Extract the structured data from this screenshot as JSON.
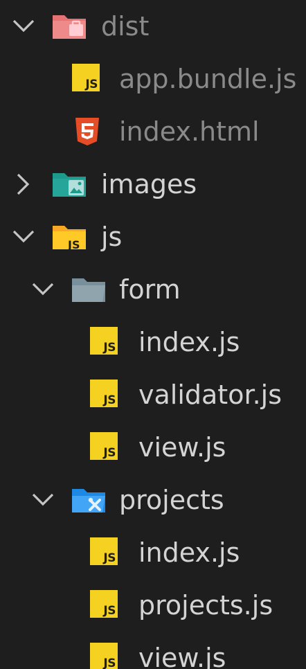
{
  "tree": {
    "dist": {
      "label": "dist",
      "expanded": true,
      "icon": "folder-dist-icon",
      "children": {
        "app_bundle": {
          "label": "app.bundle.js",
          "icon": "javascript-file-icon",
          "js_badge": "JS"
        },
        "index_html": {
          "label": "index.html",
          "icon": "html5-file-icon"
        }
      }
    },
    "images": {
      "label": "images",
      "expanded": false,
      "icon": "folder-images-icon"
    },
    "js": {
      "label": "js",
      "expanded": true,
      "icon": "folder-js-icon",
      "children": {
        "form": {
          "label": "form",
          "expanded": true,
          "icon": "folder-icon",
          "children": {
            "index": {
              "label": "index.js",
              "icon": "javascript-file-icon",
              "js_badge": "JS"
            },
            "validator": {
              "label": "validator.js",
              "icon": "javascript-file-icon",
              "js_badge": "JS"
            },
            "view": {
              "label": "view.js",
              "icon": "javascript-file-icon",
              "js_badge": "JS"
            }
          }
        },
        "projects": {
          "label": "projects",
          "expanded": true,
          "icon": "folder-projects-icon",
          "children": {
            "index": {
              "label": "index.js",
              "icon": "javascript-file-icon",
              "js_badge": "JS"
            },
            "projects": {
              "label": "projects.js",
              "icon": "javascript-file-icon",
              "js_badge": "JS"
            },
            "view": {
              "label": "view.js",
              "icon": "javascript-file-icon",
              "js_badge": "JS"
            }
          }
        }
      }
    }
  },
  "colors": {
    "background": "#1e1e1e",
    "text": "#d4d4d4",
    "text_dimmed": "#8a8a8a",
    "chevron": "#c5c5c5",
    "js_badge": "#f5d222",
    "html5": "#e44d26",
    "folder_dist": "#e57373",
    "folder_images": "#26a69a",
    "folder_js": "#ffca28",
    "folder_plain": "#90a4ae",
    "folder_projects": "#42a5f5"
  }
}
